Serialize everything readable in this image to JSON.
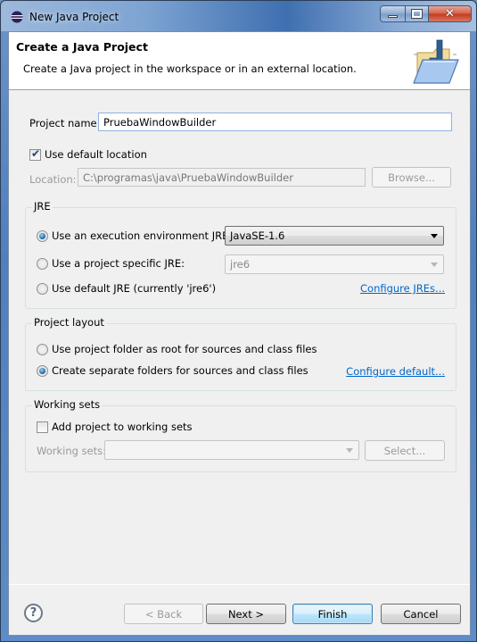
{
  "window": {
    "title": "New Java Project",
    "controls": {
      "minimize": "minimize",
      "maximize": "maximize",
      "close": "close"
    }
  },
  "banner": {
    "title": "Create a Java Project",
    "description": "Create a Java project in the workspace or in an external location."
  },
  "project": {
    "name_label": "Project name:",
    "name_value": "PruebaWindowBuilder",
    "use_default_location_label": "Use default location",
    "use_default_location_checked": true,
    "location_label": "Location:",
    "location_value": "C:\\programas\\java\\PruebaWindowBuilder",
    "browse_label": "Browse..."
  },
  "jre": {
    "group_title": "JRE",
    "options": [
      {
        "label": "Use an execution environment JRE:",
        "checked": true
      },
      {
        "label": "Use a project specific JRE:",
        "checked": false
      },
      {
        "label": "Use default JRE (currently 'jre6')",
        "checked": false
      }
    ],
    "execution_env_value": "JavaSE-1.6",
    "project_specific_value": "jre6",
    "configure_link": "Configure JREs..."
  },
  "layout": {
    "group_title": "Project layout",
    "options": [
      {
        "label": "Use project folder as root for sources and class files",
        "checked": false
      },
      {
        "label": "Create separate folders for sources and class files",
        "checked": true
      }
    ],
    "configure_link": "Configure default..."
  },
  "working_sets": {
    "group_title": "Working sets",
    "add_label": "Add project to working sets",
    "add_checked": false,
    "sets_label": "Working sets:",
    "sets_value": "",
    "select_label": "Select..."
  },
  "footer": {
    "help": "?",
    "back": "< Back",
    "next": "Next >",
    "finish": "Finish",
    "cancel": "Cancel"
  }
}
